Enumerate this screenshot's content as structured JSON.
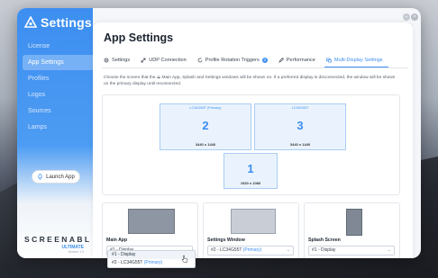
{
  "app": {
    "title": "Settings",
    "brand_icon": "screenabl-triangle-logo"
  },
  "sidebar": {
    "items": [
      {
        "label": "License",
        "active": false
      },
      {
        "label": "App Settings",
        "active": true
      },
      {
        "label": "Profiles",
        "active": false
      },
      {
        "label": "Logos",
        "active": false
      },
      {
        "label": "Sources",
        "active": false
      },
      {
        "label": "Lamps",
        "active": false
      }
    ],
    "launch_label": "Launch App",
    "logo_main": "SCREENABL",
    "logo_sub": "ULTIMATE",
    "logo_version": "Version 1.0"
  },
  "window": {
    "minimize_icon": "minimize-icon",
    "close_icon": "close-icon"
  },
  "main": {
    "title": "App Settings",
    "tabs": [
      {
        "label": "Settings",
        "icon": "gear-icon",
        "active": false
      },
      {
        "label": "UDP Connection",
        "icon": "arrows-icon",
        "active": false
      },
      {
        "label": "Profile Rotation Triggers",
        "icon": "rotate-icon",
        "active": false,
        "badge": "3"
      },
      {
        "label": "Performance",
        "icon": "rocket-icon",
        "active": false
      },
      {
        "label": "Multi-Display Settings",
        "icon": "displays-icon",
        "active": true
      }
    ],
    "description": "Choose the screen that the ⟁ Main App, Splash and Settings windows will be shown on. If a preferred display is disconnected, the window will be shown on the primary display until reconnected.",
    "monitors": [
      {
        "label": "LC34G55T (Primary)",
        "number": "2",
        "resolution": "3440 x 1440"
      },
      {
        "label": "LC34G55T",
        "number": "3",
        "resolution": "3440 x 1440"
      },
      {
        "label": "",
        "number": "1",
        "resolution": "1920 x 1080"
      }
    ],
    "cards": [
      {
        "title": "Main App",
        "select_value": "#1 - Display",
        "select_extra": ""
      },
      {
        "title": "Settings Window",
        "select_value": "#2 - LC34G55T",
        "select_extra": "(Primary)"
      },
      {
        "title": "Splash Screen",
        "select_value": "#1 - Display",
        "select_extra": ""
      }
    ],
    "dropdown_options": [
      {
        "label": "#1 - Display",
        "extra": ""
      },
      {
        "label": "#2 - LC34G55T",
        "extra": "(Primary)"
      }
    ]
  },
  "colors": {
    "accent": "#3c8ef0",
    "sidebar_top": "#3c8ef0",
    "monitor_fill": "#eaf3fd"
  }
}
